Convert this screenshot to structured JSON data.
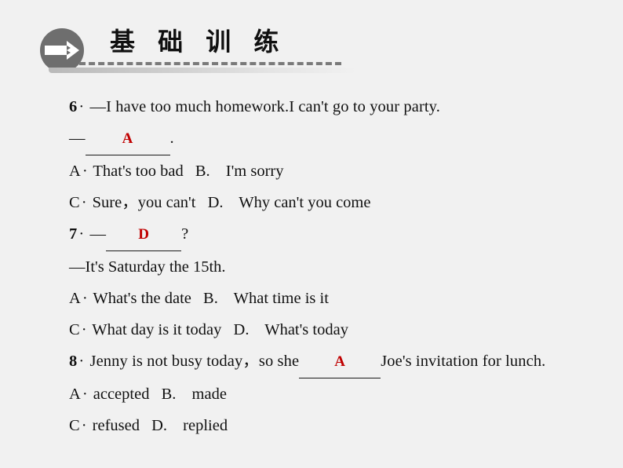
{
  "header": {
    "icon_name": "pencil-arrow-icon",
    "title": "基 础 训 练",
    "circle_color": "#6e6e6e",
    "dash_color": "#7a7a7a"
  },
  "answer_color": "#c00000",
  "background_color": "#f1f1f1",
  "questions": [
    {
      "number": "6",
      "separator": "·",
      "prompt": "—I have too much homework.I can't go to your party.",
      "reply_prefix": "—",
      "answer": "A",
      "reply_suffix": ".",
      "options": [
        {
          "letter": "A",
          "sep": "·",
          "text": "That's too bad"
        },
        {
          "letter": "B.",
          "sep": "",
          "text": "I'm sorry"
        },
        {
          "letter": "C",
          "sep": "·",
          "text": "Sure，you can't"
        },
        {
          "letter": "D.",
          "sep": "",
          "text": "Why can't you come"
        }
      ]
    },
    {
      "number": "7",
      "separator": "·",
      "prompt_prefix": "—",
      "answer": "D",
      "prompt_suffix": "?",
      "reply": "—It's Saturday the 15th.",
      "options": [
        {
          "letter": "A",
          "sep": "·",
          "text": "What's the date"
        },
        {
          "letter": "B.",
          "sep": "",
          "text": "What time is it"
        },
        {
          "letter": "C",
          "sep": "·",
          "text": "What day is it today"
        },
        {
          "letter": "D.",
          "sep": "",
          "text": "What's today"
        }
      ]
    },
    {
      "number": "8",
      "separator": "·",
      "text_before": "Jenny is not busy today，so she",
      "answer": "A",
      "text_after": "Joe's invitation for lunch.",
      "options": [
        {
          "letter": "A",
          "sep": "·",
          "text": "accepted"
        },
        {
          "letter": "B.",
          "sep": "",
          "text": "made"
        },
        {
          "letter": "C",
          "sep": "·",
          "text": "refused"
        },
        {
          "letter": "D.",
          "sep": "",
          "text": "replied"
        }
      ]
    }
  ]
}
